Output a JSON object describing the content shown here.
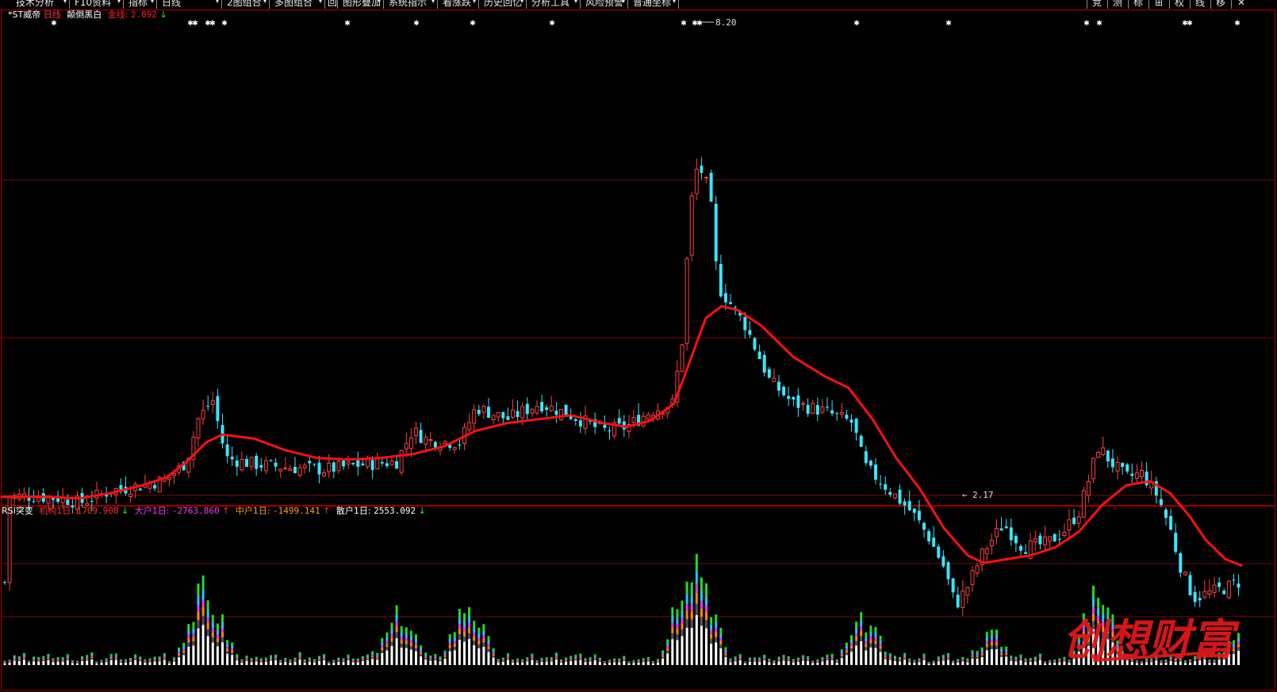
{
  "toolbar": {
    "items": [
      "技术分析",
      "F10资料",
      "指标",
      "日线",
      "2图组合",
      "多图组合",
      "图形叠加",
      "系统指示",
      "看涨跌",
      "历史回忆",
      "分析工具",
      "风险预警",
      "普通坐标"
    ],
    "box_icon": "回",
    "right": [
      "竞",
      "测",
      "标",
      "⊞",
      "权",
      "线",
      "移",
      "✕"
    ]
  },
  "main_header": {
    "stock": "*ST威帝",
    "period": "日线",
    "mode": "颠倒黑白",
    "gold_label": "金线:",
    "gold_value": "2.892",
    "gold_arrow": "↓"
  },
  "annotations": {
    "high": "8.20",
    "low": "2.17"
  },
  "sub_header": {
    "name": "RSI突变",
    "items": [
      {
        "label": "机构1日:",
        "value": "1709.908",
        "arrow": "↓",
        "color": "#ff3030"
      },
      {
        "label": "大户1日:",
        "value": "-2763.860",
        "arrow": "↑",
        "color": "#ff30ff"
      },
      {
        "label": "中户1日:",
        "value": "-1499.141",
        "arrow": "↑",
        "color": "#ff9a20"
      },
      {
        "label": "散户1日:",
        "value": "2553.092",
        "arrow": "↓",
        "color": "#ffffff"
      }
    ]
  },
  "watermark": {
    "text": "创想财富"
  },
  "chart_data": {
    "type": "candlestick",
    "high": 8.2,
    "low": 2.17,
    "ma_line_last": 2.892,
    "vol_series_colors": {
      "institution": "#ff2020",
      "big": "#20c8ff",
      "medium": "#ff8c00",
      "retail": "#ffffff",
      "extra": "#22dd22"
    }
  },
  "colors": {
    "up": "#ff4040",
    "down": "#39e6ff",
    "ma": "#ff1010",
    "grid": "#7a0a0a",
    "border": "#b00000"
  }
}
